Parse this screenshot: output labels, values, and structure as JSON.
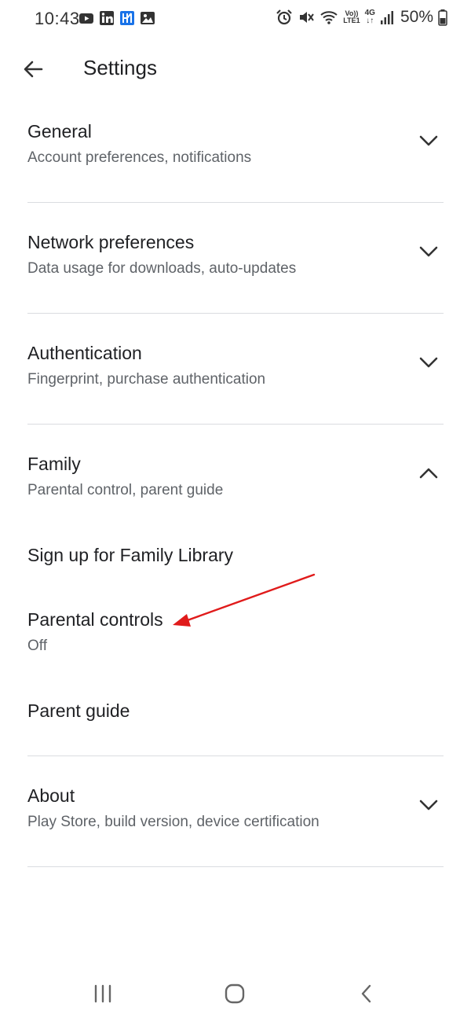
{
  "status_bar": {
    "time": "10:43",
    "battery": "50%",
    "volte_line1": "Vo))",
    "volte_line2": "LTE1",
    "network": "4G",
    "left_icons": [
      "youtube-icon",
      "linkedin-icon",
      "app-icon",
      "gallery-icon"
    ],
    "right_icons": [
      "alarm-icon",
      "mute-icon",
      "wifi-icon",
      "signal-icon",
      "battery-icon"
    ]
  },
  "header": {
    "title": "Settings"
  },
  "sections": [
    {
      "title": "General",
      "subtitle": "Account preferences, notifications",
      "expanded": false
    },
    {
      "title": "Network preferences",
      "subtitle": "Data usage for downloads, auto-updates",
      "expanded": false
    },
    {
      "title": "Authentication",
      "subtitle": "Fingerprint, purchase authentication",
      "expanded": false
    },
    {
      "title": "Family",
      "subtitle": "Parental control, parent guide",
      "expanded": true
    },
    {
      "title": "About",
      "subtitle": "Play Store, build version, device certification",
      "expanded": false
    }
  ],
  "family_items": [
    {
      "title": "Sign up for Family Library"
    },
    {
      "title": "Parental controls",
      "subtitle": "Off"
    },
    {
      "title": "Parent guide"
    }
  ],
  "nav_bar": {
    "buttons": [
      "recent-apps",
      "home",
      "back"
    ]
  },
  "colors": {
    "annotation_arrow": "#e01b1b",
    "divider": "#dadce0",
    "text_primary": "#202124",
    "text_secondary": "#5f6368"
  }
}
